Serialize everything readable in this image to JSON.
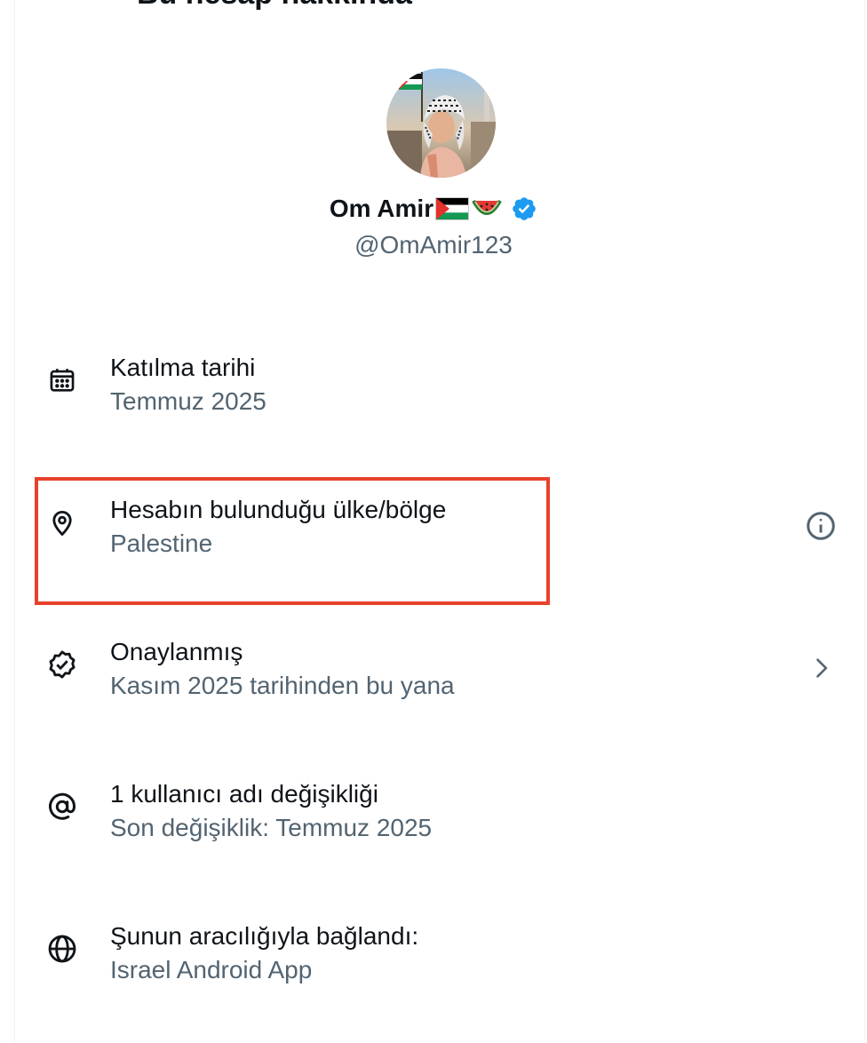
{
  "header": {
    "title": "Bu hesap hakkında"
  },
  "profile": {
    "display_name": "Om Amir",
    "handle": "@OmAmir123"
  },
  "details": [
    {
      "icon": "calendar-icon",
      "title": "Katılma tarihi",
      "value": "Temmuz 2025"
    },
    {
      "icon": "location-pin-icon",
      "title": "Hesabın bulunduğu ülke/bölge",
      "value": "Palestine",
      "action_icon": "info-icon"
    },
    {
      "icon": "verified-badge-icon",
      "title": "Onaylanmış",
      "value": "Kasım 2025 tarihinden bu yana",
      "action_icon": "chevron-right-icon"
    },
    {
      "icon": "at-sign-icon",
      "title": "1 kullanıcı adı değişikliği",
      "value": "Son değişiklik: Temmuz 2025"
    },
    {
      "icon": "globe-icon",
      "title": "Şunun aracılığıyla bağlandı:",
      "value": "Israel Android App"
    }
  ],
  "colors": {
    "primary_text": "#0f1419",
    "secondary_text": "#536471",
    "verified_blue": "#1d9bf0",
    "highlight_border": "#e8412b"
  }
}
